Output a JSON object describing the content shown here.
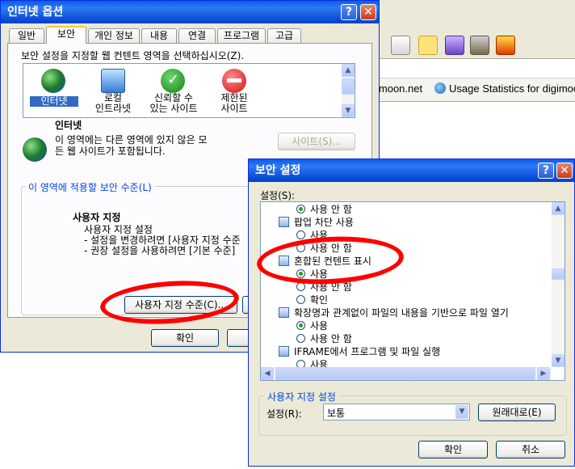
{
  "browser": {
    "links": [
      {
        "label": "imoon.net"
      },
      {
        "label": "Usage Statistics for digimoo"
      }
    ]
  },
  "options_dialog": {
    "title": "인터넷 옵션",
    "tabs": [
      "일반",
      "보안",
      "개인 정보",
      "내용",
      "연결",
      "프로그램",
      "고급"
    ],
    "zone_instruction": "보안 설정을 지정할 웹 컨텐트 영역을 선택하십시오(Z).",
    "zones": [
      {
        "label": "인터넷",
        "icon": "globe-icon"
      },
      {
        "label": "로컬\n인트라넷",
        "icon": "computer-icon"
      },
      {
        "label": "신뢰할 수\n있는 사이트",
        "icon": "check-icon"
      },
      {
        "label": "제한된\n사이트",
        "icon": "no-entry-icon"
      }
    ],
    "zone_name": "인터넷",
    "zone_desc": "이 영역에는 다른 영역에 있지 않은 모\n든 웹 사이트가 포함됩니다.",
    "sites_button": "사이트(S)...",
    "level_group_label": "이 영역에 적용할 보안 수준(L)",
    "level_title": "사용자 지정",
    "level_lines": [
      "사용자 지정 설정",
      "- 설정을 변경하려면 [사용자 지정 수준",
      "- 권장 설정을 사용하려면 [기본 수준]"
    ],
    "custom_level_button": "사용자 지정 수준(C)...",
    "ok_button": "확인",
    "title_buttons": {
      "help": "?",
      "close": "✕"
    }
  },
  "security_dialog": {
    "title": "보안 설정",
    "settings_label": "설정(S):",
    "settings": [
      {
        "kind": "option",
        "text": "사용 안 함",
        "checked": true
      },
      {
        "kind": "heading",
        "text": "팝업 차단 사용"
      },
      {
        "kind": "option",
        "text": "사용",
        "checked": false
      },
      {
        "kind": "option",
        "text": "사용 안 함",
        "checked": false
      },
      {
        "kind": "heading",
        "text": "혼합된 컨텐트 표시"
      },
      {
        "kind": "option",
        "text": "사용",
        "checked": true
      },
      {
        "kind": "option",
        "text": "사용 안 함",
        "checked": false
      },
      {
        "kind": "option",
        "text": "확인",
        "checked": false
      },
      {
        "kind": "heading",
        "text": "확장명과 관계없이 파일의 내용을 기반으로 파일 열기"
      },
      {
        "kind": "option",
        "text": "사용",
        "checked": true
      },
      {
        "kind": "option",
        "text": "사용 안 함",
        "checked": false
      },
      {
        "kind": "heading",
        "text": "IFRAME에서 프로그램 및 파일 실행"
      },
      {
        "kind": "option",
        "text": "사용",
        "checked": false
      }
    ],
    "custom_group_label": "사용자 지정 설정",
    "reset_label": "설정(R):",
    "reset_value": "보통",
    "reset_button": "원래대로(E)",
    "ok_button": "확인",
    "cancel_button": "취소",
    "title_buttons": {
      "help": "?",
      "close": "✕"
    }
  },
  "colors": {
    "annotation": "#ff0000",
    "xp_title": "#0a5ce8",
    "dialog_bg": "#ece9d8"
  }
}
